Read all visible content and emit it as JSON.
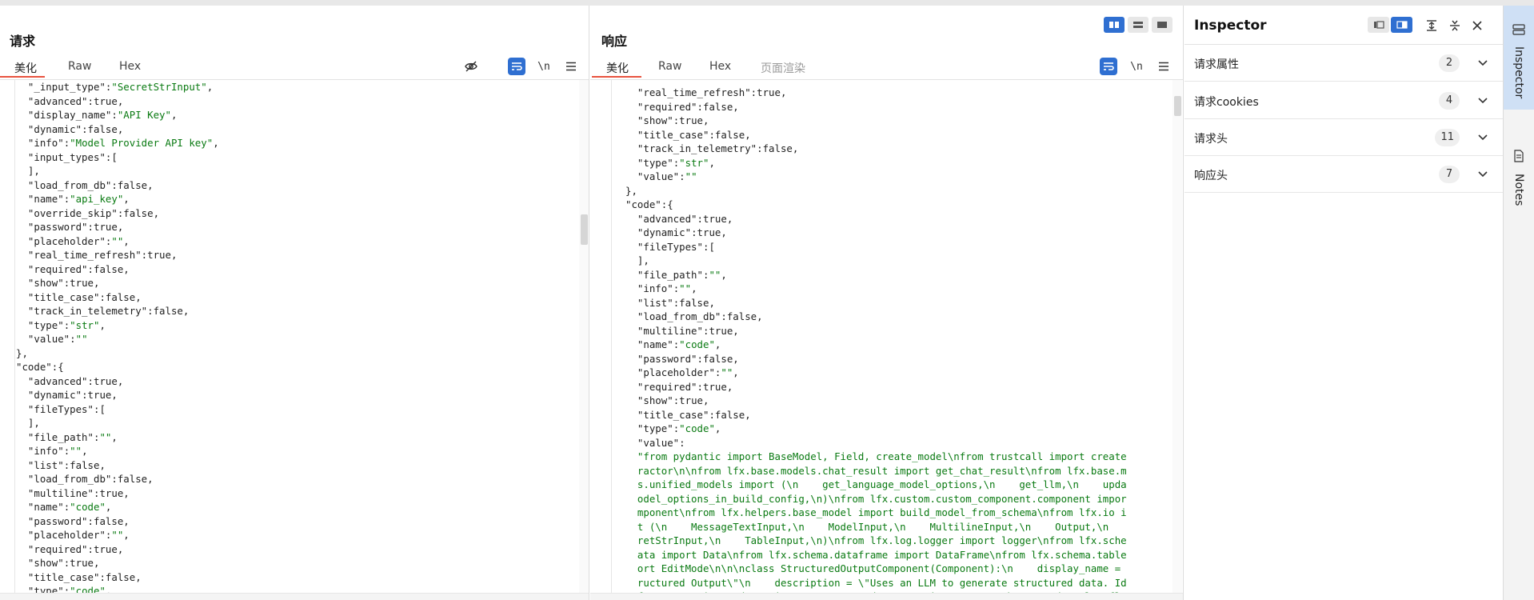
{
  "request": {
    "title": "请求",
    "tabs": [
      {
        "label": "美化",
        "active": true
      },
      {
        "label": "Raw",
        "active": false
      },
      {
        "label": "Hex",
        "active": false
      }
    ],
    "toolbar": {
      "hide_icon": "eye-off-icon",
      "wrap_icon": "wrap-lines-icon",
      "newline_label": "\\n",
      "menu_icon": "hamburger-menu-icon"
    },
    "code_lines": [
      "  \"_input_type\":\"SecretStrInput\",",
      "  \"advanced\":true,",
      "  \"display_name\":\"API Key\",",
      "  \"dynamic\":false,",
      "  \"info\":\"Model Provider API key\",",
      "  \"input_types\":[",
      "  ],",
      "  \"load_from_db\":false,",
      "  \"name\":\"api_key\",",
      "  \"override_skip\":false,",
      "  \"password\":true,",
      "  \"placeholder\":\"\",",
      "  \"real_time_refresh\":true,",
      "  \"required\":false,",
      "  \"show\":true,",
      "  \"title_case\":false,",
      "  \"track_in_telemetry\":false,",
      "  \"type\":\"str\",",
      "  \"value\":\"\"",
      "},",
      "\"code\":{",
      "  \"advanced\":true,",
      "  \"dynamic\":true,",
      "  \"fileTypes\":[",
      "  ],",
      "  \"file_path\":\"\",",
      "  \"info\":\"\",",
      "  \"list\":false,",
      "  \"load_from_db\":false,",
      "  \"multiline\":true,",
      "  \"name\":\"code\",",
      "  \"password\":false,",
      "  \"placeholder\":\"\",",
      "  \"required\":true,",
      "  \"show\":true,",
      "  \"title_case\":false,",
      "  \"type\":\"code\","
    ]
  },
  "response": {
    "title": "响应",
    "tabs": [
      {
        "label": "美化",
        "active": true
      },
      {
        "label": "Raw",
        "active": false
      },
      {
        "label": "Hex",
        "active": false
      },
      {
        "label": "页面渲染",
        "active": false
      }
    ],
    "toolbar": {
      "wrap_icon": "wrap-lines-icon",
      "newline_label": "\\n",
      "menu_icon": "hamburger-menu-icon"
    },
    "layout_buttons": [
      {
        "icon": "split-columns-icon",
        "active": true
      },
      {
        "icon": "split-rows-icon",
        "active": false
      },
      {
        "icon": "single-pane-icon",
        "active": false
      }
    ],
    "code_lines": [
      "  \"real_time_refresh\":true,",
      "  \"required\":false,",
      "  \"show\":true,",
      "  \"title_case\":false,",
      "  \"track_in_telemetry\":false,",
      "  \"type\":\"str\",",
      "  \"value\":\"\"",
      "},",
      "\"code\":{",
      "  \"advanced\":true,",
      "  \"dynamic\":true,",
      "  \"fileTypes\":[",
      "  ],",
      "  \"file_path\":\"\",",
      "  \"info\":\"\",",
      "  \"list\":false,",
      "  \"load_from_db\":false,",
      "  \"multiline\":true,",
      "  \"name\":\"code\",",
      "  \"password\":false,",
      "  \"placeholder\":\"\",",
      "  \"required\":true,",
      "  \"show\":true,",
      "  \"title_case\":false,",
      "  \"type\":\"code\",",
      "  \"value\":",
      "  \"from pydantic import BaseModel, Field, create_model\\nfrom trustcall import create",
      "  ractor\\n\\nfrom lfx.base.models.chat_result import get_chat_result\\nfrom lfx.base.m",
      "  s.unified_models import (\\n    get_language_model_options,\\n    get_llm,\\n    upda",
      "  odel_options_in_build_config,\\n)\\nfrom lfx.custom.custom_component.component impor",
      "  mponent\\nfrom lfx.helpers.base_model import build_model_from_schema\\nfrom lfx.io i",
      "  t (\\n    MessageTextInput,\\n    ModelInput,\\n    MultilineInput,\\n    Output,\\n",
      "  retStrInput,\\n    TableInput,\\n)\\nfrom lfx.log.logger import logger\\nfrom lfx.sche",
      "  ata import Data\\nfrom lfx.schema.dataframe import DataFrame\\nfrom lfx.schema.table",
      "  ort EditMode\\n\\n\\nclass StructuredOutputComponent(Component):\\n    display_name =",
      "  ructured Output\\\"\\n    description = \\\"Uses an LLM to generate structured data. Id",
      "  for extraction and consistency.\\\"\\n    documentation: str = \\\"https://docs.langfl"
    ]
  },
  "inspector": {
    "title": "Inspector",
    "rows": [
      {
        "label": "请求属性",
        "count": "2"
      },
      {
        "label": "请求cookies",
        "count": "4"
      },
      {
        "label": "请求头",
        "count": "11"
      },
      {
        "label": "响应头",
        "count": "7"
      }
    ]
  },
  "side_tabs": [
    {
      "label": "Inspector",
      "icon": "inspector-icon",
      "active": true
    },
    {
      "label": "Notes",
      "icon": "notes-icon",
      "active": false
    }
  ]
}
